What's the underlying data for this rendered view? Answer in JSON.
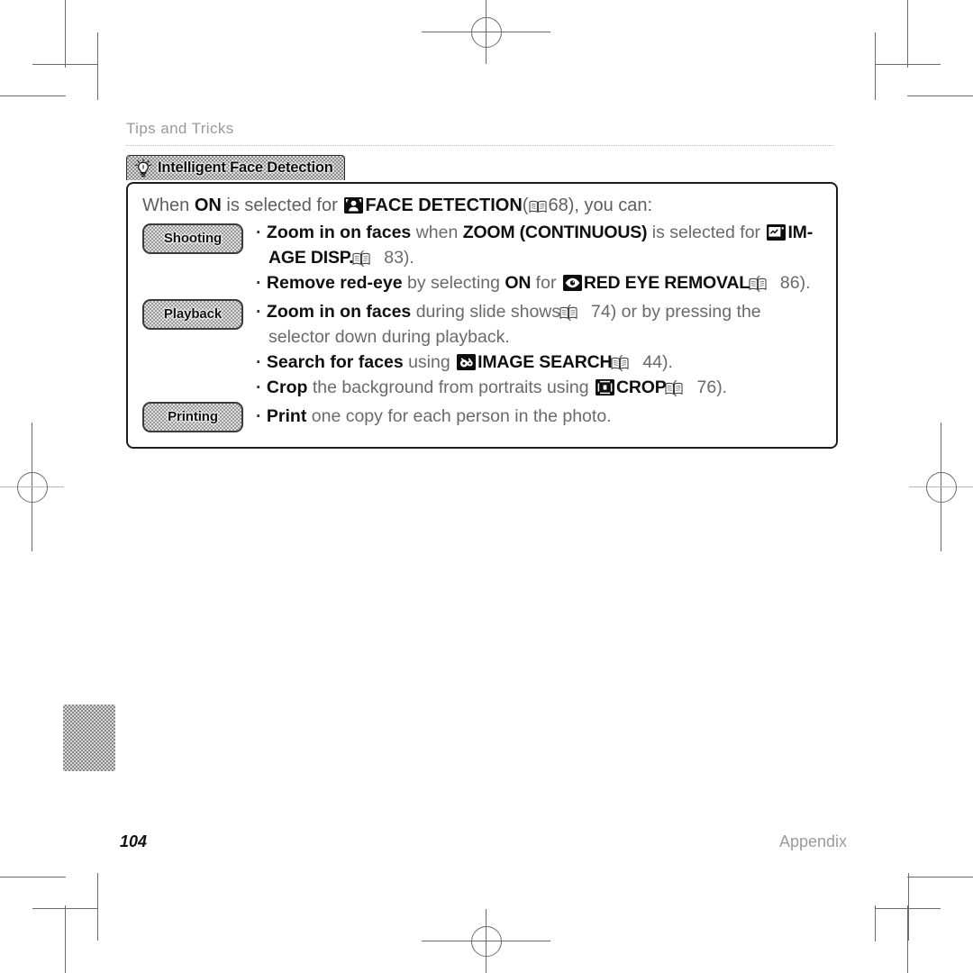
{
  "page": {
    "running_head": "Tips and Tricks",
    "folio": "104",
    "section": "Appendix"
  },
  "note": {
    "tab_title": "Intelligent Face Detection",
    "tab_icon": "lightbulb-icon",
    "intro": {
      "text_1": "When ",
      "bold_on": "ON",
      "text_2": " is selected for ",
      "icon": "face-detection-icon",
      "heading": "FACE DETECTION",
      "ref_open": "(",
      "ref_icon": "book-icon",
      "ref_page": "68",
      "ref_close": "), you can:"
    },
    "side_tabs": [
      {
        "label": "Shooting"
      },
      {
        "label": "Playback"
      },
      {
        "label": "Printing"
      }
    ],
    "bullets": [
      {
        "id": "zoom-in-on-faces-shooting",
        "dot": "·",
        "lead": "Zoom in on faces",
        "mid_1": " when ",
        "cap_1": "ZOOM (CONTINUOUS)",
        "mid_2": " is selected for ",
        "icon": "image-display-icon",
        "cap_2": "IM-​AGE DISP.",
        "ref_open": " (",
        "ref_icon": "book-icon",
        "ref_page": "83",
        "ref_close": ")."
      },
      {
        "id": "remove-red-eye",
        "dot": "·",
        "lead": "Remove red-eye",
        "mid_1": " by selecting ",
        "cap_1": "ON",
        "mid_2": " for ",
        "icon": "red-eye-removal-icon",
        "cap_2": "RED EYE REMOVAL",
        "ref_open": " (",
        "ref_icon": "book-icon",
        "ref_page": "86",
        "ref_close": ")."
      },
      {
        "id": "zoom-in-on-faces-playback",
        "dot": "·",
        "lead": "Zoom in on faces",
        "mid_1": " during slide shows (",
        "ref_icon": "book-icon",
        "ref_page": "74",
        "tail": ") or by pressing the selector down during playback."
      },
      {
        "id": "search-for-faces",
        "dot": "·",
        "lead": "Search for faces",
        "mid_1": " using ",
        "icon": "image-search-icon",
        "cap_2": "IMAGE SEARCH",
        "ref_open": " (",
        "ref_icon": "book-icon",
        "ref_page": "44",
        "ref_close": ")."
      },
      {
        "id": "crop-background",
        "dot": "·",
        "lead": "Crop",
        "mid_1": " the background from portraits using ",
        "icon": "crop-icon",
        "cap_2": "CROP",
        "ref_open": " (",
        "ref_icon": "book-icon",
        "ref_page": "76",
        "ref_close": ")."
      },
      {
        "id": "print-one-copy",
        "dot": "·",
        "lead": "Print",
        "mid_1": " one copy for each person in the photo."
      }
    ]
  },
  "colors": {
    "ink": "#101010",
    "body_text": "#6a6a6a",
    "rule": "#bdbdbd",
    "crop_mark": "#6b6b6b",
    "tab_fill": "#c9c9c9"
  }
}
